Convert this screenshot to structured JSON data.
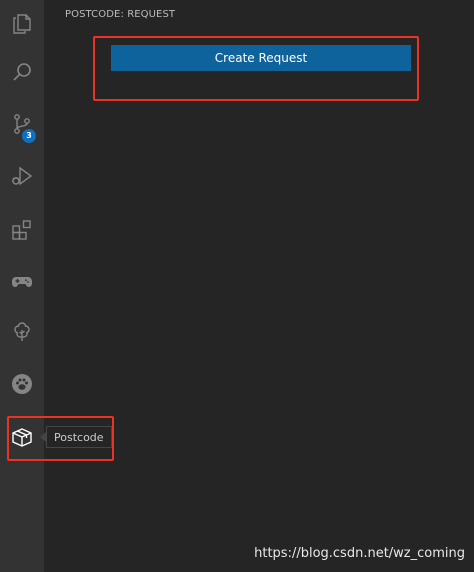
{
  "sidebar": {
    "title": "POSTCODE: REQUEST",
    "create_button_label": "Create Request"
  },
  "activity_bar": {
    "items": [
      {
        "icon": "files-icon"
      },
      {
        "icon": "search-icon"
      },
      {
        "icon": "source-control-icon",
        "badge": "3"
      },
      {
        "icon": "run-debug-icon"
      },
      {
        "icon": "extensions-icon"
      },
      {
        "icon": "gamepad-icon"
      },
      {
        "icon": "tree-icon"
      },
      {
        "icon": "paw-icon"
      },
      {
        "icon": "package-icon",
        "tooltip": "Postcode"
      }
    ]
  },
  "watermark": "https://blog.csdn.net/wz_coming",
  "colors": {
    "activity_bar": "#333333",
    "sidebar": "#252526",
    "button": "#0e639c",
    "badge": "#0e70c0",
    "highlight": "#ea3323"
  }
}
